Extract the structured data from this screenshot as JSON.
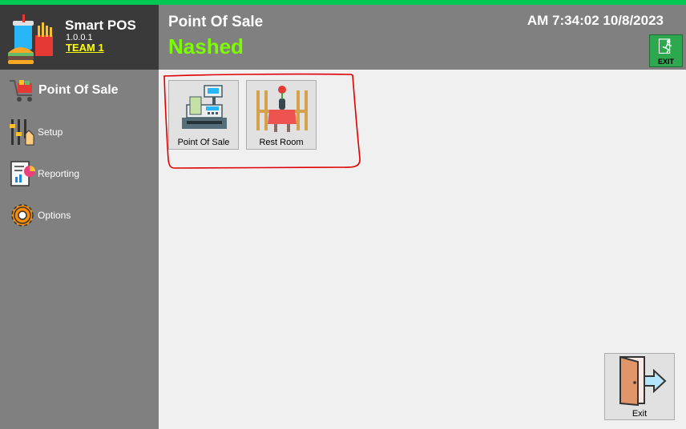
{
  "app": {
    "name": "Smart POS",
    "version": "1.0.0.1",
    "team": "TEAM 1"
  },
  "sidebar": {
    "items": [
      {
        "label": "Point Of Sale",
        "icon": "cart-icon",
        "active": true
      },
      {
        "label": "Setup",
        "icon": "sliders-icon"
      },
      {
        "label": "Reporting",
        "icon": "report-icon"
      },
      {
        "label": "Options",
        "icon": "gear-icon"
      }
    ]
  },
  "header": {
    "title": "Point Of Sale",
    "user": "Nashed",
    "clock": "AM 7:34:02 10/8/2023",
    "exit_label": "EXIT"
  },
  "main": {
    "tiles": [
      {
        "label": "Point Of Sale",
        "icon": "cash-register-icon"
      },
      {
        "label": "Rest Room",
        "icon": "dining-table-icon"
      }
    ],
    "exit_button": {
      "label": "Exit",
      "icon": "exit-door-icon"
    }
  },
  "colors": {
    "accent_strip": "#00c853",
    "user_name": "#7cfc00",
    "team_link": "#ffff00",
    "annotation": "#e00000"
  }
}
